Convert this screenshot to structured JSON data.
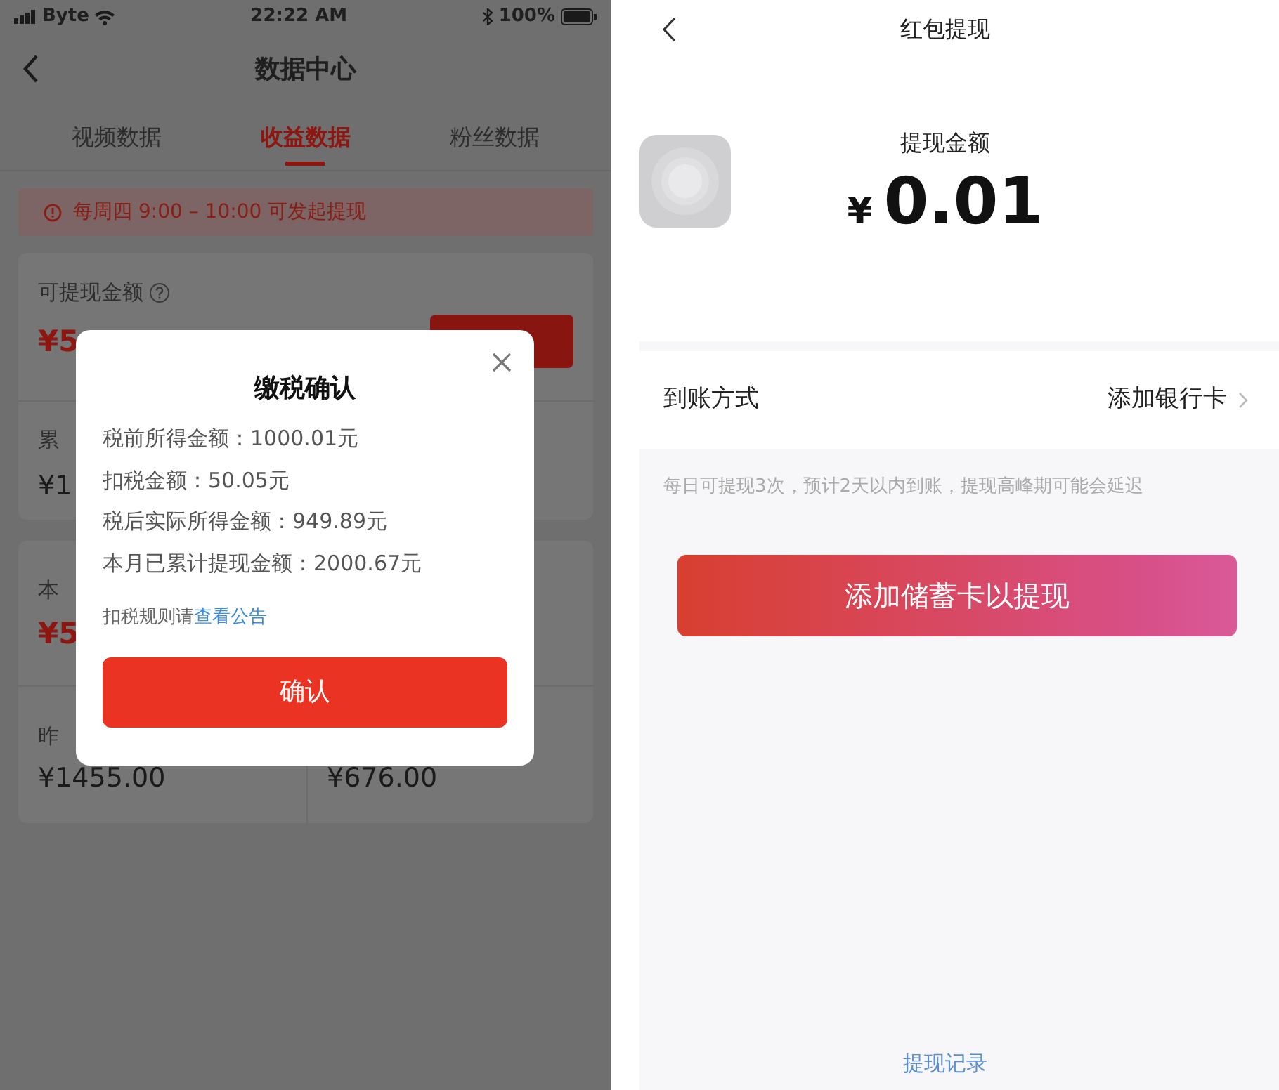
{
  "left_screen": {
    "status_bar": {
      "carrier": "Byte",
      "time": "22:22 AM",
      "battery": "100%"
    },
    "nav": {
      "title": "数据中心"
    },
    "tabs": [
      {
        "label": "视频数据",
        "selected": false
      },
      {
        "label": "收益数据",
        "selected": true
      },
      {
        "label": "粉丝数据",
        "selected": false
      }
    ],
    "notice": "每周四 9:00 – 10:00 可发起提现",
    "balance_card": {
      "label": "可提现金额",
      "amount": "¥5",
      "rows": [
        {
          "label": "累",
          "value": "¥1"
        }
      ]
    },
    "stats_card": {
      "label": "本",
      "amount": "¥5",
      "columns": [
        {
          "label": "昨",
          "value": "¥1455.00"
        },
        {
          "value": "¥676.00"
        }
      ]
    },
    "dialog": {
      "title": "缴税确认",
      "lines": [
        "税前所得金额：1000.01元",
        "扣税金额：50.05元",
        "税后实际所得金额：949.89元",
        "本月已累计提现金额：2000.67元"
      ],
      "note": {
        "text": "扣税规则请",
        "link": "查看公告"
      },
      "button": "确认"
    }
  },
  "right_screen": {
    "nav": {
      "title": "红包提现"
    },
    "amount_label": "提现金额",
    "currency": "¥",
    "amount": "0.01",
    "method": {
      "label": "到账方式",
      "value": "添加银行卡"
    },
    "hint": "每日可提现3次，预计2天以内到账，提现高峰期可能会延迟",
    "button": "添加储蓄卡以提现",
    "footer_link": "提现记录"
  }
}
